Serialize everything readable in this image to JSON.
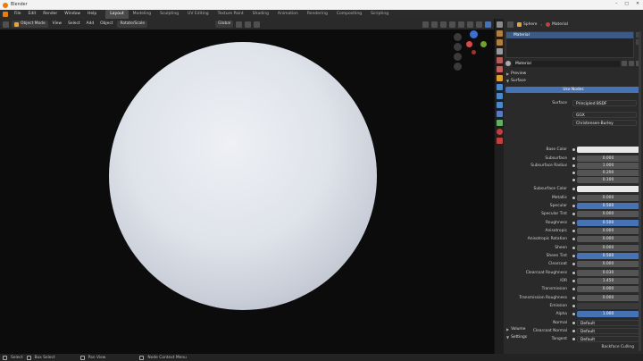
{
  "window": {
    "title": "Blender",
    "buttons": [
      "–",
      "□",
      "✕"
    ]
  },
  "menu": {
    "items": [
      "File",
      "Edit",
      "Render",
      "Window",
      "Help"
    ],
    "tabs": [
      "Layout",
      "Modeling",
      "Sculpting",
      "UV Editing",
      "Texture Paint",
      "Shading",
      "Animation",
      "Rendering",
      "Compositing",
      "Scripting"
    ],
    "active_tab": "Layout"
  },
  "viewport_header": {
    "mode": "Object Mode",
    "view": "View",
    "select": "Select",
    "add": "Add",
    "object": "Object",
    "shading": "Rotate/Scale",
    "orientation": "Global"
  },
  "properties": {
    "object": "Sphere",
    "material_tab": "Material",
    "slot": "Material",
    "material_name": "Material",
    "preview": "Preview",
    "surface_section": "Surface",
    "use_nodes": "Use Nodes",
    "surface": {
      "label": "Surface",
      "value": "Principled BSDF"
    },
    "distribution": "GGX",
    "subsurface_method": "Christensen-Burley",
    "rows": [
      {
        "label": "Base Color",
        "value": "",
        "style": "white"
      },
      {
        "label": "Subsurface",
        "value": "0.000",
        "style": ""
      },
      {
        "label": "Subsurface Radius",
        "value": "1.000",
        "style": ""
      },
      {
        "label": "",
        "value": "0.200",
        "style": ""
      },
      {
        "label": "",
        "value": "0.100",
        "style": ""
      },
      {
        "label": "Subsurface Color",
        "value": "",
        "style": "white"
      },
      {
        "label": "Metallic",
        "value": "0.000",
        "style": ""
      },
      {
        "label": "Specular",
        "value": "0.500",
        "style": "blue"
      },
      {
        "label": "Specular Tint",
        "value": "0.000",
        "style": ""
      },
      {
        "label": "Roughness",
        "value": "0.500",
        "style": "blue"
      },
      {
        "label": "Anisotropic",
        "value": "0.000",
        "style": ""
      },
      {
        "label": "Anisotropic Rotation",
        "value": "0.000",
        "style": ""
      },
      {
        "label": "Sheen",
        "value": "0.000",
        "style": ""
      },
      {
        "label": "Sheen Tint",
        "value": "0.500",
        "style": "blue"
      },
      {
        "label": "Clearcoat",
        "value": "0.000",
        "style": ""
      },
      {
        "label": "Clearcoat Roughness",
        "value": "0.030",
        "style": ""
      },
      {
        "label": "IOR",
        "value": "1.450",
        "style": ""
      },
      {
        "label": "Transmission",
        "value": "0.000",
        "style": ""
      },
      {
        "label": "Transmission Roughness",
        "value": "0.000",
        "style": ""
      },
      {
        "label": "Emission",
        "value": "",
        "style": "dark"
      },
      {
        "label": "Alpha",
        "value": "1.000",
        "style": "blue"
      },
      {
        "label": "Normal",
        "value": "Default",
        "style": "drop"
      },
      {
        "label": "Clearcoat Normal",
        "value": "Default",
        "style": "drop"
      },
      {
        "label": "Tangent",
        "value": "Default",
        "style": "drop"
      }
    ],
    "volume": "Volume",
    "settings": "Settings",
    "backface": "Backface Culling"
  },
  "status": {
    "select": "Select",
    "box_select": "Box Select",
    "pan": "Pan View",
    "context": "Node Context Menu"
  },
  "colors": {
    "accent": "#4772b3",
    "blender_orange": "#e87d0d"
  }
}
